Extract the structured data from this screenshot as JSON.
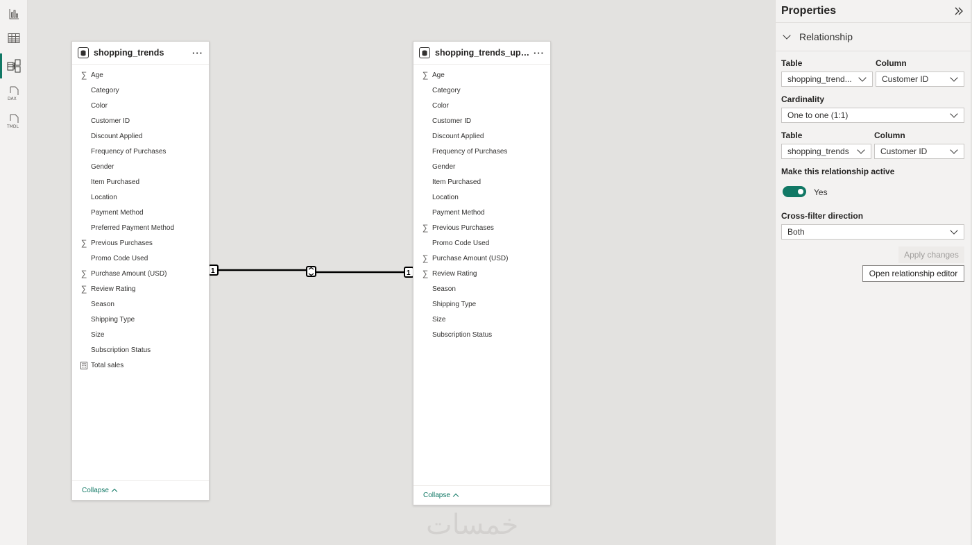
{
  "rail": {
    "items": [
      {
        "name": "report-view-icon"
      },
      {
        "name": "table-view-icon"
      },
      {
        "name": "model-view-icon"
      },
      {
        "name": "dax-query-view-icon",
        "label": "DAX"
      },
      {
        "name": "tmdl-view-icon",
        "label": "TMDL"
      }
    ]
  },
  "tables": [
    {
      "title": "shopping_trends",
      "more": "···",
      "collapse_label": "Collapse",
      "fields": [
        {
          "name": "Age",
          "icon": "sigma"
        },
        {
          "name": "Category",
          "icon": ""
        },
        {
          "name": "Color",
          "icon": ""
        },
        {
          "name": "Customer ID",
          "icon": ""
        },
        {
          "name": "Discount Applied",
          "icon": ""
        },
        {
          "name": "Frequency of Purchases",
          "icon": ""
        },
        {
          "name": "Gender",
          "icon": ""
        },
        {
          "name": "Item Purchased",
          "icon": ""
        },
        {
          "name": "Location",
          "icon": ""
        },
        {
          "name": "Payment Method",
          "icon": ""
        },
        {
          "name": "Preferred Payment Method",
          "icon": ""
        },
        {
          "name": "Previous Purchases",
          "icon": "sigma"
        },
        {
          "name": "Promo Code Used",
          "icon": ""
        },
        {
          "name": "Purchase Amount (USD)",
          "icon": "sigma"
        },
        {
          "name": "Review Rating",
          "icon": "sigma"
        },
        {
          "name": "Season",
          "icon": ""
        },
        {
          "name": "Shipping Type",
          "icon": ""
        },
        {
          "name": "Size",
          "icon": ""
        },
        {
          "name": "Subscription Status",
          "icon": ""
        },
        {
          "name": "Total sales",
          "icon": "calculator"
        }
      ]
    },
    {
      "title": "shopping_trends_updat...",
      "more": "···",
      "collapse_label": "Collapse",
      "fields": [
        {
          "name": "Age",
          "icon": "sigma"
        },
        {
          "name": "Category",
          "icon": ""
        },
        {
          "name": "Color",
          "icon": ""
        },
        {
          "name": "Customer ID",
          "icon": ""
        },
        {
          "name": "Discount Applied",
          "icon": ""
        },
        {
          "name": "Frequency of Purchases",
          "icon": ""
        },
        {
          "name": "Gender",
          "icon": ""
        },
        {
          "name": "Item Purchased",
          "icon": ""
        },
        {
          "name": "Location",
          "icon": ""
        },
        {
          "name": "Payment Method",
          "icon": ""
        },
        {
          "name": "Previous Purchases",
          "icon": "sigma"
        },
        {
          "name": "Promo Code Used",
          "icon": ""
        },
        {
          "name": "Purchase Amount (USD)",
          "icon": "sigma"
        },
        {
          "name": "Review Rating",
          "icon": "sigma"
        },
        {
          "name": "Season",
          "icon": ""
        },
        {
          "name": "Shipping Type",
          "icon": ""
        },
        {
          "name": "Size",
          "icon": ""
        },
        {
          "name": "Subscription Status",
          "icon": ""
        }
      ]
    }
  ],
  "relationship": {
    "left_cardinality": "1",
    "right_cardinality": "1"
  },
  "watermark": "خمسات",
  "properties": {
    "title": "Properties",
    "section": "Relationship",
    "table_label": "Table",
    "column_label": "Column",
    "from_table": "shopping_trend...",
    "from_column": "Customer ID",
    "cardinality_label": "Cardinality",
    "cardinality": "One to one (1:1)",
    "to_table": "shopping_trends",
    "to_column": "Customer ID",
    "active_label": "Make this relationship active",
    "active_value": "Yes",
    "crossfilter_label": "Cross-filter direction",
    "crossfilter": "Both",
    "apply_label": "Apply changes",
    "editor_label": "Open relationship editor"
  },
  "colors": {
    "accent": "#117865",
    "canvas": "#e3e2e0",
    "panel": "#f3f2f1"
  }
}
